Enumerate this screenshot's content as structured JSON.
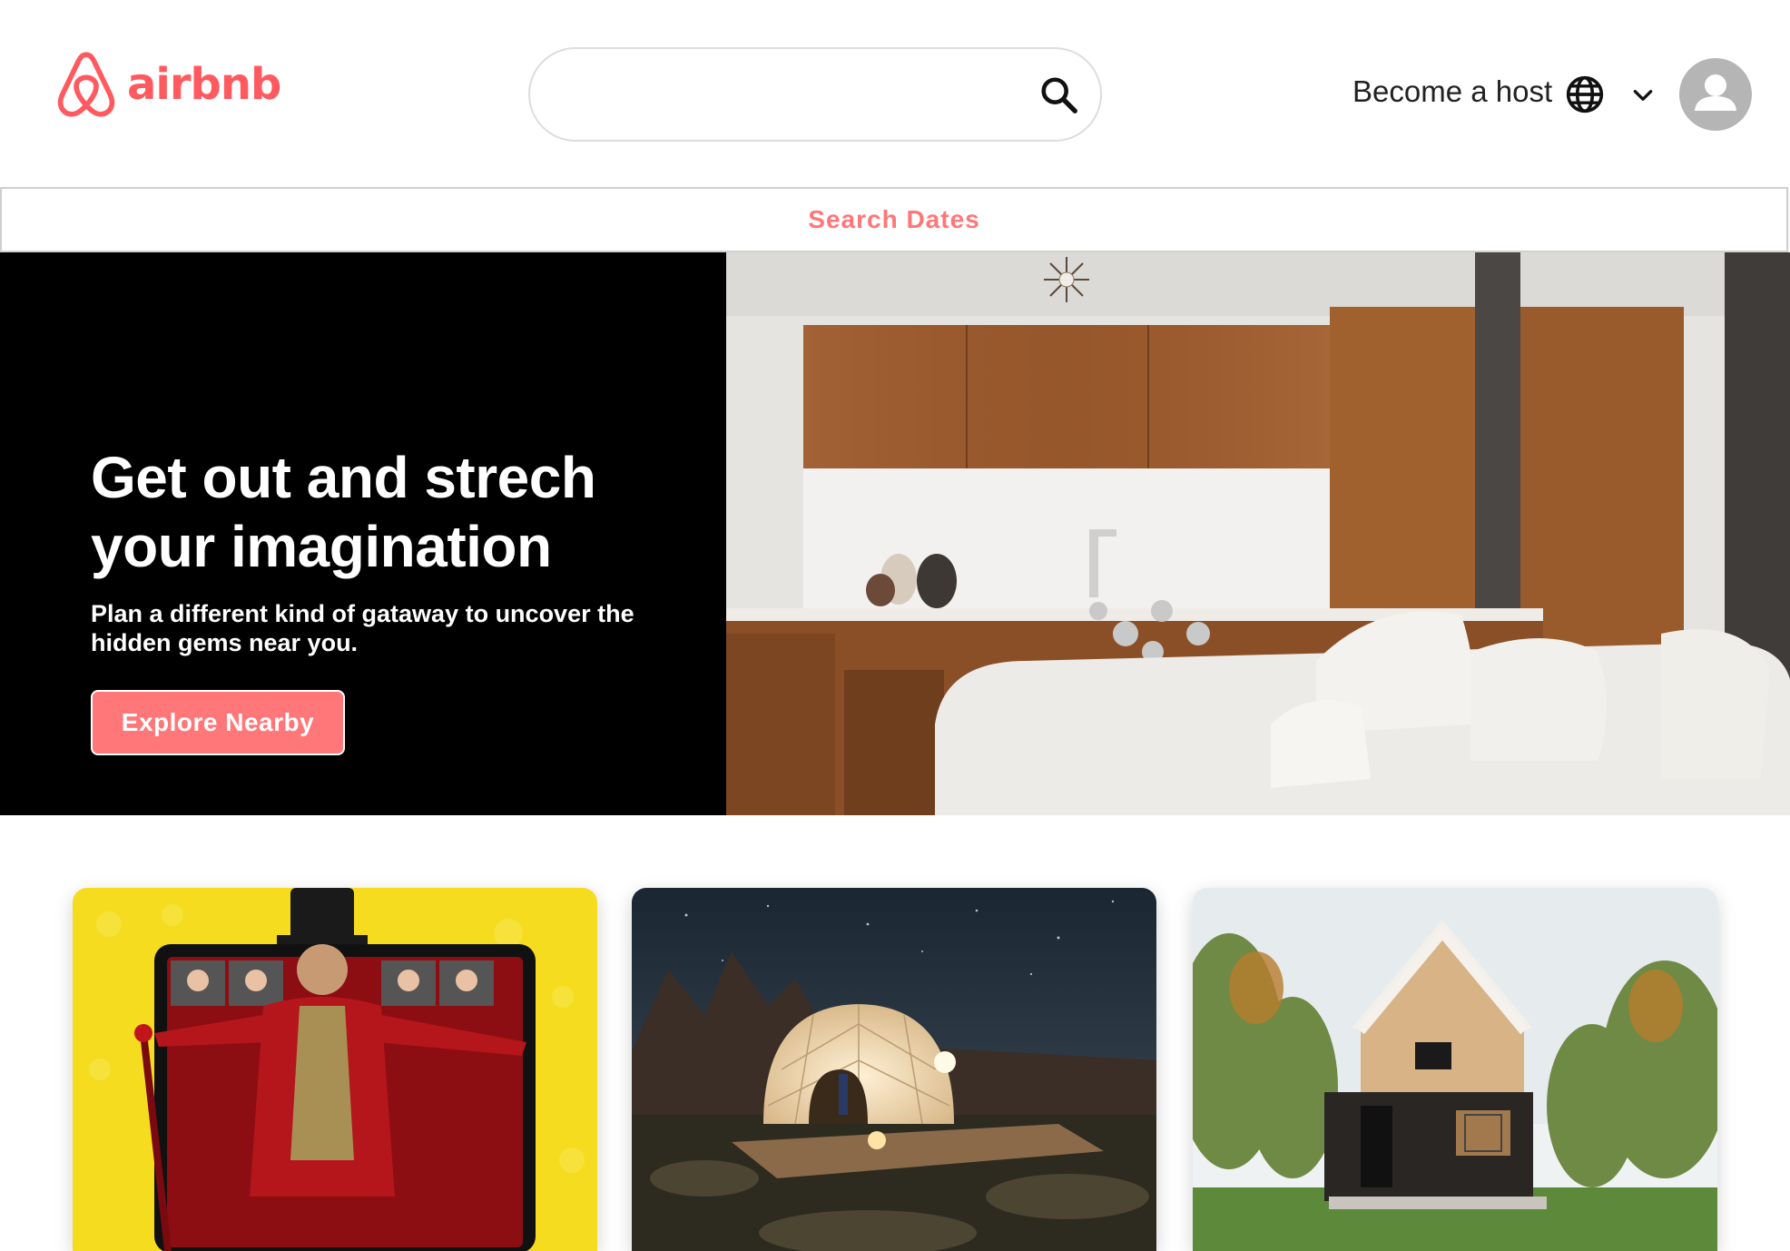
{
  "brand": {
    "name": "airbnb",
    "color": "#FF5A5F"
  },
  "header": {
    "search": {
      "placeholder": "",
      "value": ""
    },
    "host_link": "Become a host",
    "icons": [
      "airbnb-logo-icon",
      "search-icon",
      "globe-icon",
      "chevron-down-icon",
      "user-avatar-icon"
    ]
  },
  "dates_bar": {
    "label": "Search Dates",
    "color": "#FF7779"
  },
  "hero": {
    "title": "Get out and strech your imagination",
    "subtitle": "Plan a different kind of gataway to uncover the hidden gems near you.",
    "button": "Explore Nearby",
    "button_color": "#FF7779",
    "image": "modern kitchen and living room interior"
  },
  "cards": [
    {
      "image": "online experience performer on tablet"
    },
    {
      "image": "illuminated geodesic dome tent at night"
    },
    {
      "image": "modern wooden cabin in forest"
    }
  ]
}
